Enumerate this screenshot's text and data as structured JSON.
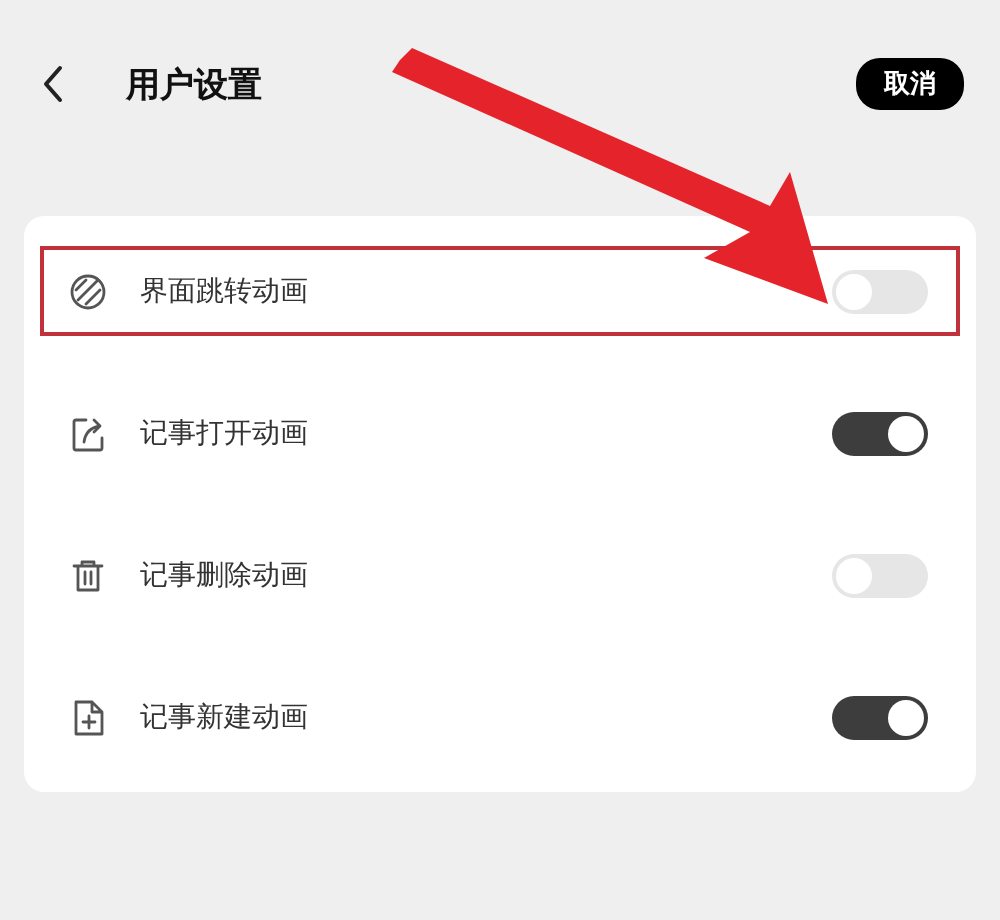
{
  "header": {
    "title": "用户设置",
    "cancel_button": "取消"
  },
  "settings": [
    {
      "label": "界面跳转动画",
      "on": false,
      "highlighted": true
    },
    {
      "label": "记事打开动画",
      "on": true,
      "highlighted": false
    },
    {
      "label": "记事删除动画",
      "on": false,
      "highlighted": false
    },
    {
      "label": "记事新建动画",
      "on": true,
      "highlighted": false
    }
  ],
  "annotation": {
    "kind": "arrow"
  }
}
